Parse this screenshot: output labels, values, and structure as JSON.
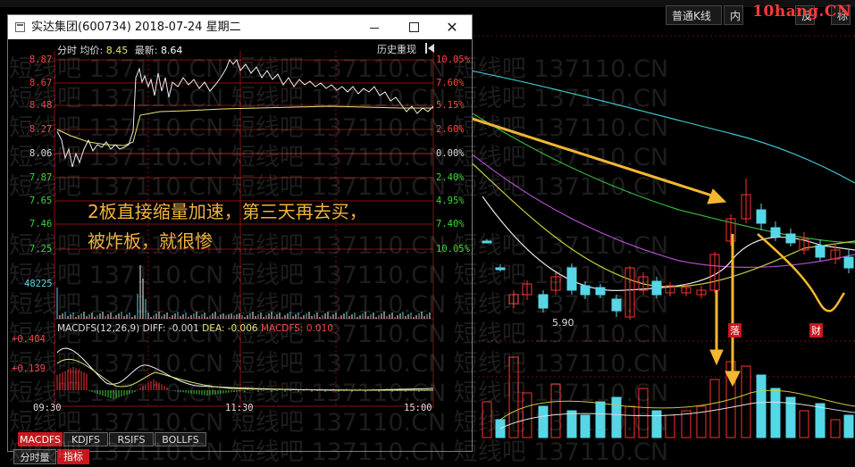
{
  "brand": {
    "text": "10hang.CN",
    "color": "#ff2a2a"
  },
  "top_tabs": [
    {
      "label": "普通K线"
    },
    {
      "label": "内"
    },
    {
      "label": "反"
    },
    {
      "label": "标"
    }
  ],
  "window": {
    "title": "实达集团(600734) 2018-07-24 星期二",
    "min_icon": "minimize-icon",
    "max_icon": "maximize-icon",
    "close_glyph": "✕"
  },
  "intraday": {
    "header_label": "分时",
    "avg_label": "均价:",
    "avg_value": "8.45",
    "latest_label": "最新:",
    "latest_value": "8.64",
    "history_button": "历史重现",
    "price_ticks": [
      "8.87",
      "8.67",
      "8.48",
      "8.27",
      "8.06",
      "7.87",
      "7.65",
      "7.46",
      "7.25"
    ],
    "pct_ticks": [
      "10.05%",
      "7.60%",
      "5.15%",
      "2.60%",
      "0.00%",
      "2.40%",
      "4.95%",
      "7.40%",
      "10.05%"
    ],
    "volume_tick": "48225",
    "macd_header": {
      "label": "MACDFS(12,26,9)",
      "diff_label": "DIFF:",
      "diff_value": "-0.001",
      "dea_label": "DEA:",
      "dea_value": "-0.006",
      "macdfs_label": "MACDFS:",
      "macdfs_value": "0.010"
    },
    "macd_ticks": [
      "+0.404",
      "+0.139"
    ],
    "time_ticks": [
      "09:30",
      "11:30",
      "15:00"
    ]
  },
  "annotation": {
    "line1": "2板直接缩量加速，第三天再去买，",
    "line2": "被炸板，就很惨",
    "color": "#f2b43a"
  },
  "indicator_tabs": [
    "MACDFS",
    "KDJFS",
    "RSIFS",
    "BOLLFS"
  ],
  "bottom_tabs": [
    "分时量",
    "指标"
  ],
  "kline": {
    "low_label": "5.90",
    "marker_1": "落",
    "marker_2": "财"
  },
  "watermark": {
    "text": "短线吧 137110.CN 短线吧 137110.CN 短线吧 137110.CN"
  },
  "colors": {
    "up": "#ff3030",
    "down": "#54d8e8",
    "arrow": "#f5b731",
    "grid": "#8a1010"
  }
}
